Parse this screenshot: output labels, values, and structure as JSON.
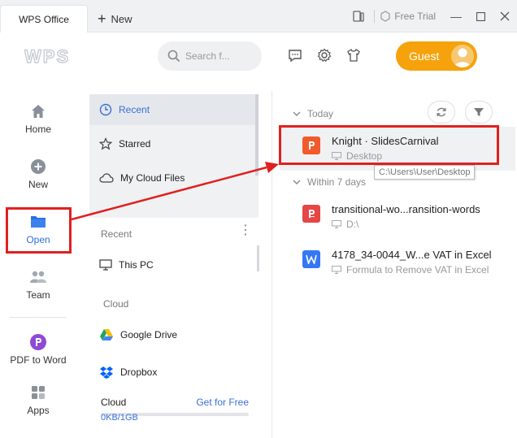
{
  "titlebar": {
    "tab_label": "WPS Office",
    "new_tab_label": "New",
    "free_trial": "Free Trial"
  },
  "header": {
    "logo_text": "WPS",
    "search_placeholder": "Search f...",
    "guest_label": "Guest"
  },
  "leftnav": {
    "items": [
      {
        "label": "Home",
        "icon": "home-icon"
      },
      {
        "label": "New",
        "icon": "plus-circle-icon"
      },
      {
        "label": "Open",
        "icon": "folder-icon"
      },
      {
        "label": "Team",
        "icon": "team-icon"
      },
      {
        "label": "PDF to Word",
        "icon": "pdf-to-word-icon"
      },
      {
        "label": "Apps",
        "icon": "apps-icon"
      }
    ]
  },
  "midcol": {
    "top_items": [
      {
        "label": "Recent",
        "icon": "clock-icon"
      },
      {
        "label": "Starred",
        "icon": "star-icon"
      },
      {
        "label": "My Cloud Files",
        "icon": "cloud-icon"
      }
    ],
    "recent_label": "Recent",
    "recent_items": [
      {
        "label": "This PC",
        "icon": "monitor-icon"
      }
    ],
    "cloud_label": "Cloud",
    "cloud_items": [
      {
        "label": "Google Drive",
        "icon": "google-drive-icon"
      },
      {
        "label": "Dropbox",
        "icon": "dropbox-icon"
      }
    ],
    "storage": {
      "label": "Cloud",
      "action": "Get for Free",
      "usage": "0KB/1GB"
    }
  },
  "files": {
    "today_label": "Today",
    "within_label": "Within 7 days",
    "today": [
      {
        "name": "Knight · SlidesCarnival",
        "location": "Desktop",
        "type": "presentation"
      }
    ],
    "within": [
      {
        "name": "transitional-wo...ransition-words",
        "location": "D:\\",
        "type": "pdf"
      },
      {
        "name": "4178_34-0044_W...e VAT in Excel",
        "location": "Formula to Remove VAT in Excel",
        "type": "writer"
      }
    ],
    "tooltip": "C:\\Users\\User\\Desktop"
  },
  "colors": {
    "accent_blue": "#3a6fd8",
    "guest_orange": "#f5a20d",
    "annotation_red": "#e02020",
    "presentation_orange": "#f15b2b",
    "pdf_red": "#e54646",
    "writer_blue": "#3478f6"
  }
}
